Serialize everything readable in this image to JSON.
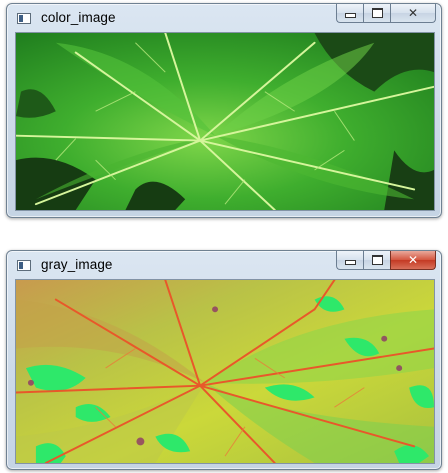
{
  "windows": [
    {
      "title": "color_image",
      "icon": "app-window-icon",
      "controls": {
        "minimize": "minimize-icon",
        "maximize": "maximize-icon",
        "close": "close-icon"
      },
      "close_active": false
    },
    {
      "title": "gray_image",
      "icon": "app-window-icon",
      "controls": {
        "minimize": "minimize-icon",
        "maximize": "maximize-icon",
        "close": "close-icon"
      },
      "close_active": true
    }
  ],
  "colors": {
    "leaf_green": "#2f9f2a",
    "vein_light": "#c9f28a",
    "gray_bg": "#b8c94a",
    "gray_veins": "#e0602a",
    "gray_spots": "#2ee85f",
    "close_active": "#c94330"
  }
}
